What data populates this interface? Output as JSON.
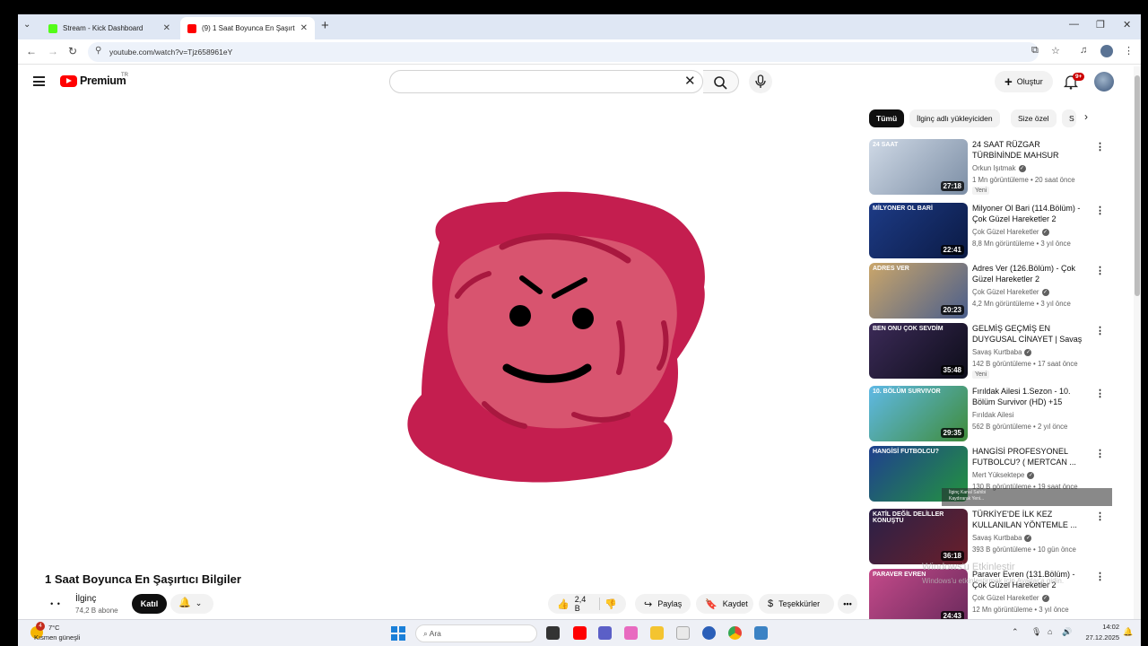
{
  "browser": {
    "tabs": [
      {
        "label": "Stream - Kick Dashboard"
      },
      {
        "label": "(9) 1 Saat Boyunca En Şaşırtıcı Bilgiler"
      }
    ],
    "url": "youtube.com/watch?v=Tjz658961eY"
  },
  "youtube": {
    "logo_text": "Premium",
    "region": "TR",
    "create_label": "Oluştur",
    "notification_count": "9+"
  },
  "video": {
    "title": "1 Saat Boyunca En Şaşırtıcı Bilgiler",
    "channel": "İlginç",
    "channel_avatar": "• •",
    "subscribers": "74,2 B abone",
    "join_label": "Katıl",
    "likes": "2,4 B",
    "share_label": "Paylaş",
    "save_label": "Kaydet",
    "thanks_label": "Teşekkürler"
  },
  "chips": [
    "Tümü",
    "İlginç adlı yükleyiciden",
    "Size özel",
    "S"
  ],
  "recommendations": [
    {
      "title": "24 SAAT RÜZGAR TÜRBİNİNDE MAHSUR KALMAK!",
      "channel": "Orkun Işıtmak",
      "verified": true,
      "views": "1 Mn görüntüleme",
      "age": "20 saat önce",
      "badge": "Yeni",
      "duration": "27:18",
      "thumb_label": "24 SAAT",
      "thumb_colors": [
        "#cfd9e6",
        "#7c8ea5"
      ]
    },
    {
      "title": "Milyoner Ol Bari (114.Bölüm) - Çok Güzel Hareketler 2",
      "channel": "Çok Güzel Hareketler",
      "verified": true,
      "views": "8,8 Mn görüntüleme",
      "age": "3 yıl önce",
      "badge": "",
      "duration": "22:41",
      "thumb_label": "MİLYONER OL BARİ",
      "thumb_colors": [
        "#1d3b86",
        "#0b1a44"
      ]
    },
    {
      "title": "Adres Ver (126.Bölüm) - Çok Güzel Hareketler 2",
      "channel": "Çok Güzel Hareketler",
      "verified": true,
      "views": "4,2 Mn görüntüleme",
      "age": "3 yıl önce",
      "badge": "",
      "duration": "20:23",
      "thumb_label": "ADRES VER",
      "thumb_colors": [
        "#caa66a",
        "#4a5e8c"
      ]
    },
    {
      "title": "GELMİŞ GEÇMİŞ EN DUYGUSAL CİNAYET | Savaş Kurtbaba ile ...",
      "channel": "Savaş Kurtbaba",
      "verified": true,
      "views": "142 B görüntüleme",
      "age": "17 saat önce",
      "badge": "Yeni",
      "duration": "35:48",
      "thumb_label": "BEN ONU ÇOK SEVDİM",
      "thumb_colors": [
        "#3b2a57",
        "#0d0d19"
      ]
    },
    {
      "title": "Fırıldak Ailesi 1.Sezon - 10. Bölüm Survivor (HD) +15",
      "channel": "Fırıldak Ailesi",
      "verified": false,
      "views": "562 B görüntüleme",
      "age": "2 yıl önce",
      "badge": "",
      "duration": "29:35",
      "thumb_label": "10. BÖLÜM SURVIVOR",
      "thumb_colors": [
        "#5fb9e6",
        "#3f8c3a"
      ]
    },
    {
      "title": "HANGİSİ PROFESYONEL FUTBOLCU? ( MERTCAN ...",
      "channel": "Mert Yüksektepe",
      "verified": true,
      "views": "130 B görüntüleme",
      "age": "19 saat önce",
      "badge": "",
      "duration": "",
      "thumb_label": "HANGİSİ FUTBOLCU?",
      "thumb_colors": [
        "#1f3f8f",
        "#23943f"
      ]
    },
    {
      "title": "TÜRKİYE'DE İLK KEZ KULLANILAN YÖNTEMLE ...",
      "channel": "Savaş Kurtbaba",
      "verified": true,
      "views": "393 B görüntüleme",
      "age": "10 gün önce",
      "badge": "",
      "duration": "36:18",
      "thumb_label": "KATİL DEĞİL DELİLLER KONUŞTU",
      "thumb_colors": [
        "#2a2048",
        "#6a1f2a"
      ]
    },
    {
      "title": "Paraver Evren (131.Bölüm) - Çok Güzel Hareketler 2",
      "channel": "Çok Güzel Hareketler",
      "verified": true,
      "views": "12 Mn görüntüleme",
      "age": "3 yıl önce",
      "badge": "",
      "duration": "24:43",
      "thumb_label": "PARAVER EVREN",
      "thumb_colors": [
        "#c44a8a",
        "#6a2a5c"
      ]
    }
  ],
  "overlays": {
    "tooltip_line1": "İlginç Kanal Sahibi",
    "tooltip_line2": "Kaydırarak Yeni...",
    "watermark_line1": "Windows'u Etkinleştir",
    "watermark_line2": "Windows'u etkinleştirmek için Ayarlar'a gidin."
  },
  "taskbar": {
    "weather_badge": "4",
    "temperature": "7°C",
    "weather": "Kısmen güneşli",
    "search_placeholder": "Ara",
    "time": "14:02",
    "date": "27.12.2025"
  },
  "colors": {
    "youtube_red": "#ff0000",
    "blob_outer": "#c41e4f",
    "blob_inner": "#d8546f"
  }
}
